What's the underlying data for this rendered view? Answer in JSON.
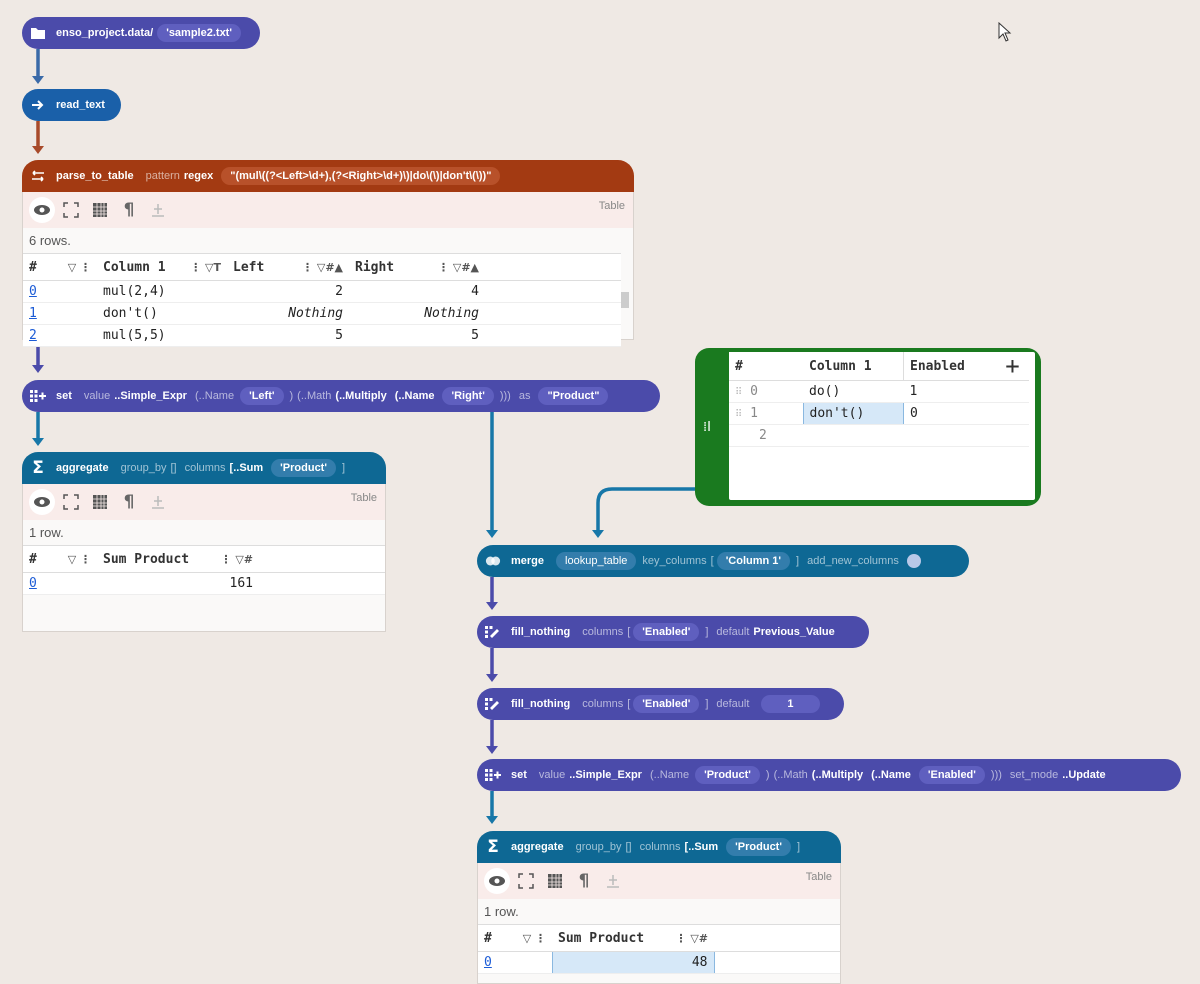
{
  "nodes": {
    "data": {
      "title": "enso_project.data/",
      "file": "'sample2.txt'"
    },
    "read": {
      "title": "read_text"
    },
    "parse": {
      "title": "parse_to_table",
      "arg_pattern": "pattern",
      "kw": "regex",
      "regex": "\"(mul\\((?<Left>\\d+),(?<Right>\\d+)\\)|do\\(\\)|don't\\(\\))\""
    },
    "set1": {
      "title": "set",
      "arg_value": "value",
      "expr": "..Simple_Expr",
      "op1": "(..Name",
      "name1": "'Left'",
      "sep1": ")",
      "op2": "(..Math",
      "op3": "(..Multiply",
      "op4": "(..Name",
      "name2": "'Right'",
      "close": ")))",
      "arg_as": "as",
      "as_val": "\"Product\""
    },
    "agg1": {
      "title": "aggregate",
      "arg_group": "group_by",
      "group_val": "[]",
      "arg_columns": "columns",
      "cols_open": "[..Sum",
      "col": "'Product'",
      "cols_close": "]"
    },
    "merge": {
      "title": "merge",
      "lookup": "lookup_table",
      "arg_key": "key_columns",
      "key_open": "[",
      "key": "'Column 1'",
      "key_close": "]",
      "arg_add": "add_new_columns"
    },
    "fill1": {
      "title": "fill_nothing",
      "arg_columns": "columns",
      "open": "[",
      "col": "'Enabled'",
      "close": "]",
      "arg_default": "default",
      "default_val": "Previous_Value"
    },
    "fill2": {
      "title": "fill_nothing",
      "arg_columns": "columns",
      "open": "[",
      "col": "'Enabled'",
      "close": "]",
      "arg_default": "default",
      "default_val": "1"
    },
    "set2": {
      "title": "set",
      "arg_value": "value",
      "expr": "..Simple_Expr",
      "op1": "(..Name",
      "name1": "'Product'",
      "sep1": ")",
      "op2": "(..Math",
      "op3": "(..Multiply",
      "op4": "(..Name",
      "name2": "'Enabled'",
      "close": ")))",
      "arg_mode": "set_mode",
      "mode_val": "..Update"
    },
    "agg2": {
      "title": "aggregate",
      "arg_group": "group_by",
      "group_val": "[]",
      "arg_columns": "columns",
      "cols_open": "[..Sum",
      "col": "'Product'",
      "cols_close": "]"
    }
  },
  "viz1": {
    "label": "Table",
    "rows_text": "6 rows.",
    "headers": [
      "#",
      "Column 1",
      "Left",
      "Right"
    ],
    "rows": [
      [
        "0",
        "mul(2,4)",
        "2",
        "4"
      ],
      [
        "1",
        "don't()",
        "Nothing",
        "Nothing"
      ],
      [
        "2",
        "mul(5,5)",
        "5",
        "5"
      ]
    ]
  },
  "viz2": {
    "label": "Table",
    "rows_text": "1 row.",
    "headers": [
      "#",
      "Sum Product"
    ],
    "rows": [
      [
        "0",
        "161"
      ]
    ]
  },
  "viz3": {
    "label": "Table",
    "rows_text": "1 row.",
    "headers": [
      "#",
      "Sum Product"
    ],
    "rows": [
      [
        "0",
        "48"
      ]
    ]
  },
  "lookup_table": {
    "headers": [
      "#",
      "Column 1",
      "Enabled",
      "+"
    ],
    "rows": [
      [
        "0",
        "do()",
        "1"
      ],
      [
        "1",
        "don't()",
        "0"
      ],
      [
        "2",
        "",
        ""
      ]
    ]
  },
  "colors": {
    "indigo": "#4b4baa",
    "blue": "#1a60a9",
    "brown": "#a33a12",
    "teal": "#0e6894",
    "green": "#1a7a1f",
    "background": "#efe9e4"
  },
  "icons": [
    "folder-icon",
    "read-arrow-icon",
    "parse-icon",
    "add-column-icon",
    "sigma-icon",
    "merge-icon",
    "fill-icon",
    "eye-icon",
    "expand-icon",
    "table-icon",
    "pilcrow-icon",
    "chart-icon",
    "filter-icon",
    "menu-dots-icon",
    "sort-icon",
    "add-icon",
    "drag-handle-icon",
    "mouse-cursor-icon"
  ]
}
